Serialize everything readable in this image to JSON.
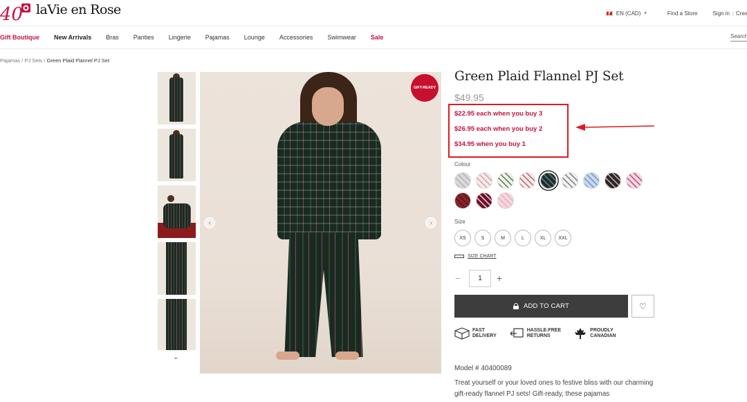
{
  "header": {
    "logo_mark": "40",
    "logo_text": "laVie en Rose",
    "language": "EN (CAD)",
    "find_store": "Find a Store",
    "sign_in": "Sign in",
    "divider": "|",
    "create": "Crea"
  },
  "nav": {
    "items": [
      {
        "label": "Gift Boutique",
        "style": "red"
      },
      {
        "label": "New Arrivals",
        "style": "bold"
      },
      {
        "label": "Bras",
        "style": ""
      },
      {
        "label": "Panties",
        "style": ""
      },
      {
        "label": "Lingerie",
        "style": ""
      },
      {
        "label": "Pajamas",
        "style": ""
      },
      {
        "label": "Lounge",
        "style": ""
      },
      {
        "label": "Accessories",
        "style": ""
      },
      {
        "label": "Swimwear",
        "style": ""
      },
      {
        "label": "Sale",
        "style": "red"
      }
    ],
    "search_placeholder": "Search"
  },
  "breadcrumb": {
    "crumb1": "Pajamas",
    "sep": " / ",
    "crumb2": "PJ Sets",
    "current": "Green Plaid Flannel PJ Set"
  },
  "gallery": {
    "badge": "GIFT-READY",
    "prev": "‹",
    "next": "›",
    "thumbs_down": "⌄"
  },
  "product": {
    "title": "Green Plaid Flannel PJ Set",
    "price": "$49.95",
    "promos": [
      "$22.95 each when you buy 3",
      "$26.95 each when you buy 2",
      "$34.95 when you buy 1"
    ],
    "colour_label": "Colour",
    "swatches": [
      {
        "c1": "#d9d9d9",
        "c2": "#b8b8b8",
        "selected": false
      },
      {
        "c1": "#f7ecea",
        "c2": "#d9a7ad",
        "selected": false
      },
      {
        "c1": "#f2f2ee",
        "c2": "#6b8c5e",
        "selected": false
      },
      {
        "c1": "#f7efe9",
        "c2": "#c66f7d",
        "selected": false
      },
      {
        "c1": "#1d2b3a",
        "c2": "#5f7a5e",
        "selected": true
      },
      {
        "c1": "#f3f3f3",
        "c2": "#8a8a8a",
        "selected": false
      },
      {
        "c1": "#c8d8ef",
        "c2": "#7f9cc9",
        "selected": false
      },
      {
        "c1": "#1e2540",
        "c2": "#d3a05f",
        "selected": false
      },
      {
        "c1": "#f4d9e1",
        "c2": "#c65a7c",
        "selected": false
      },
      {
        "c1": "#9b1c25",
        "c2": "#2a2a2a",
        "selected": false
      },
      {
        "c1": "#6a1028",
        "c2": "#e5b7c3",
        "selected": false
      },
      {
        "c1": "#f5d7de",
        "c2": "#e9b3c0",
        "selected": false
      }
    ],
    "size_label": "Size",
    "sizes": [
      "XS",
      "S",
      "M",
      "L",
      "XL",
      "XXL"
    ],
    "size_chart": "SIZE CHART",
    "qty_minus": "−",
    "qty": "1",
    "qty_plus": "+",
    "add_to_cart": "ADD TO CART",
    "wishlist_icon": "♡",
    "features": [
      {
        "icon": "box-icon",
        "l1": "FAST",
        "l2": "DELIVERY"
      },
      {
        "icon": "return-icon",
        "l1": "HASSLE-FREE",
        "l2": "RETURNS"
      },
      {
        "icon": "maple-leaf-icon",
        "l1": "PROUDLY",
        "l2": "CANADIAN"
      }
    ],
    "model_number": "Model # 40400089",
    "description": "Treat yourself or your loved ones to festive bliss with our charming gift-ready flannel PJ sets! Gift-ready, these pajamas"
  },
  "colors": {
    "accent_red": "#c5123f",
    "annotation_red": "#e0191e",
    "cart_bg": "#3d3d3d"
  }
}
